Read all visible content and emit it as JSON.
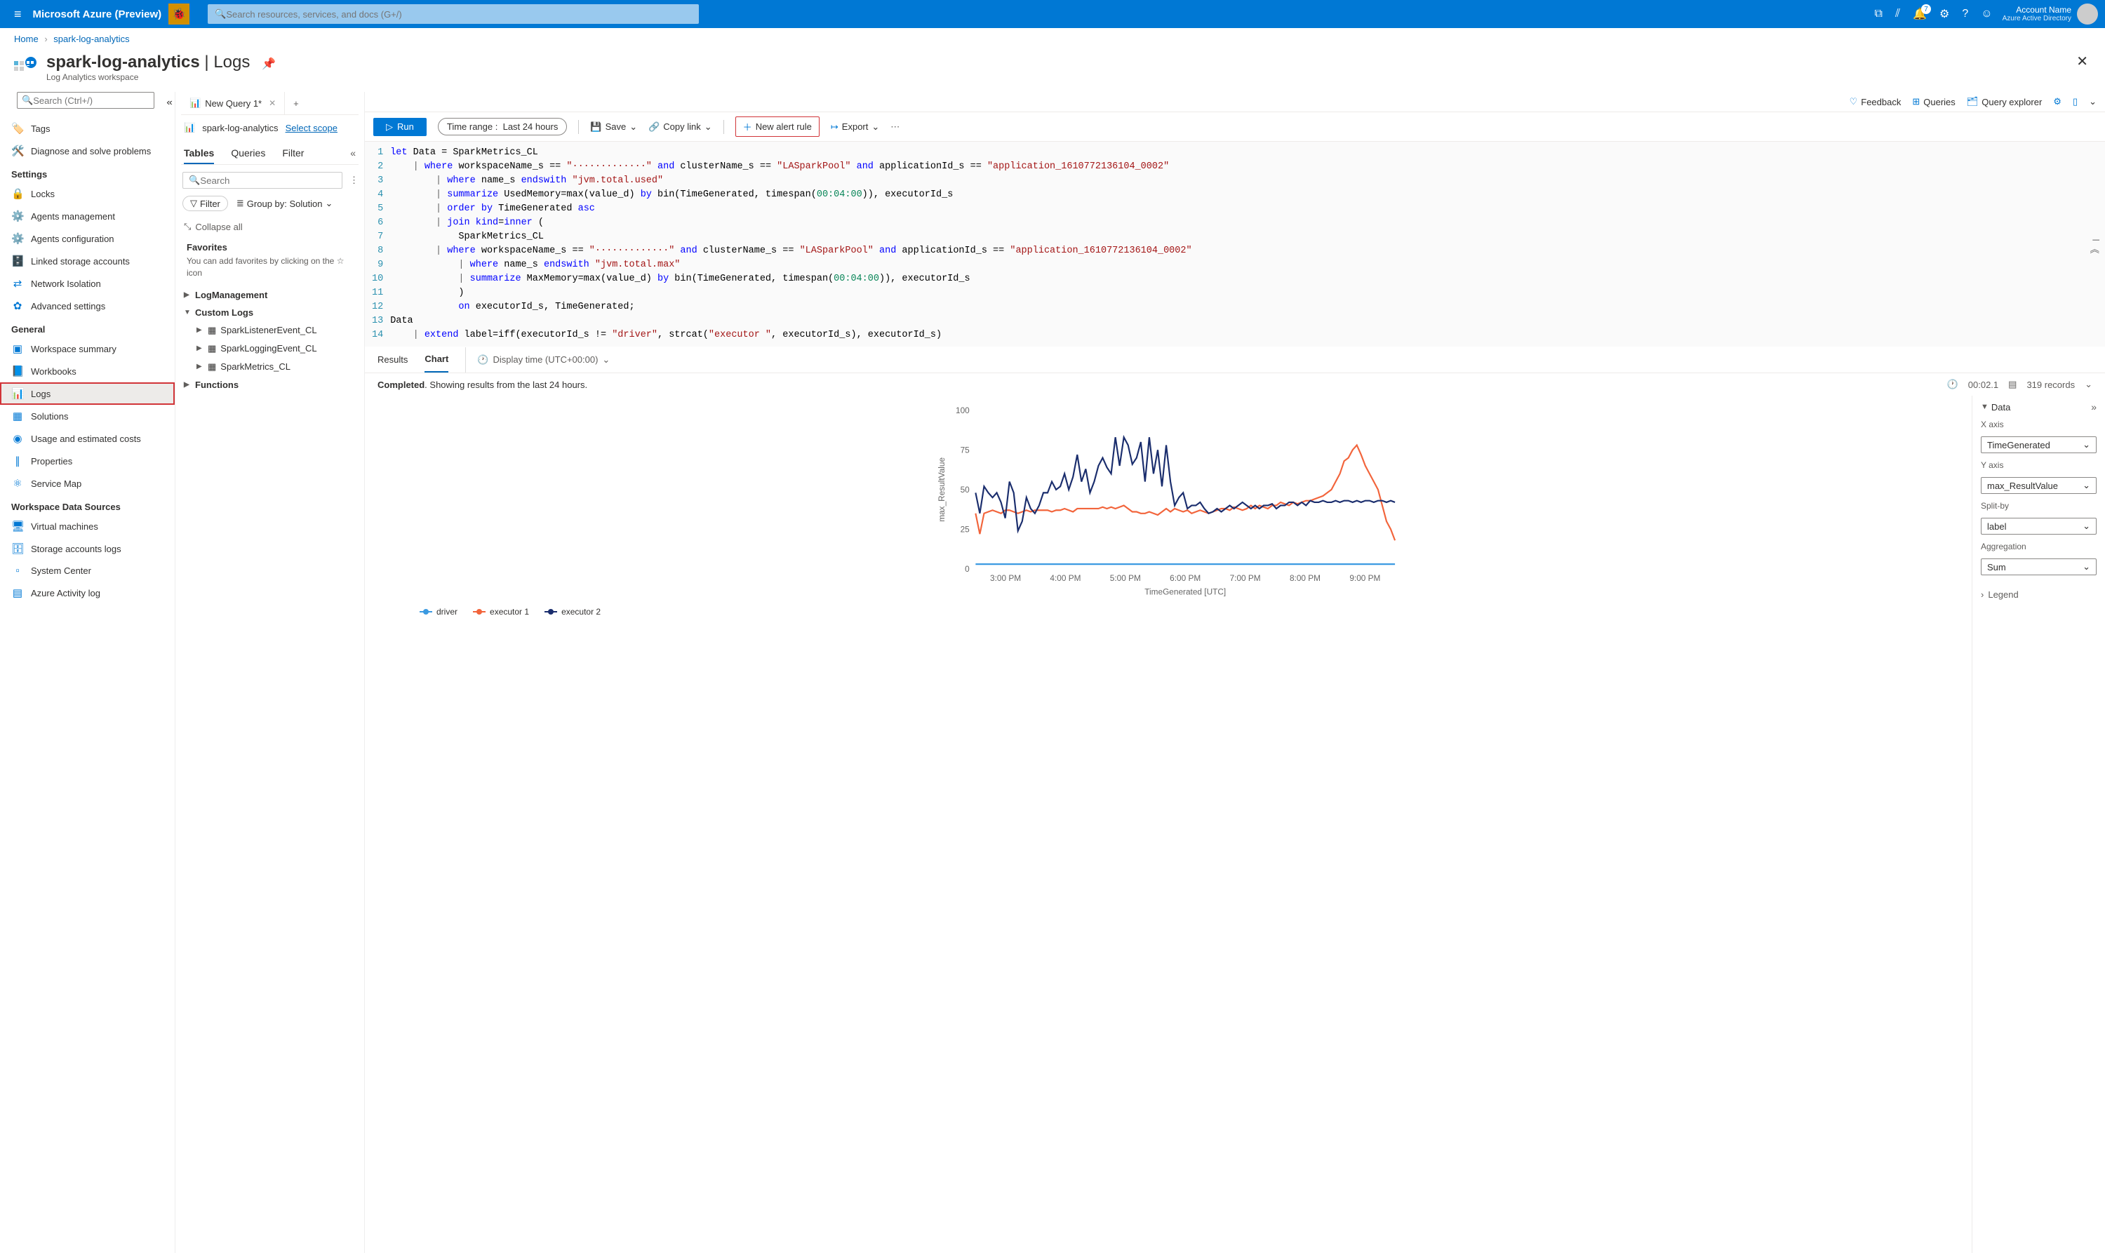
{
  "topbar": {
    "brand": "Microsoft Azure (Preview)",
    "search_placeholder": "Search resources, services, and docs (G+/)",
    "notif_count": "7",
    "account_name": "Account Name",
    "tenant": "Azure Active Directory"
  },
  "breadcrumb": {
    "home": "Home",
    "current": "spark-log-analytics"
  },
  "page": {
    "title_main": "spark-log-analytics",
    "title_sep": " | ",
    "title_section": "Logs",
    "subtitle": "Log Analytics workspace"
  },
  "sidebar_search_placeholder": "Search (Ctrl+/)",
  "sidebar": {
    "top": [
      {
        "icon": "🏷️",
        "label": "Tags",
        "color": "#8a4fbf"
      },
      {
        "icon": "🛠️",
        "label": "Diagnose and solve problems",
        "color": "#605e5c"
      }
    ],
    "settings_label": "Settings",
    "settings": [
      {
        "icon": "🔒",
        "label": "Locks",
        "color": "#0078d4"
      },
      {
        "icon": "⚙️",
        "label": "Agents management",
        "color": "#0078d4"
      },
      {
        "icon": "⚙️",
        "label": "Agents configuration",
        "color": "#0078d4"
      },
      {
        "icon": "🗄️",
        "label": "Linked storage accounts",
        "color": "#0078d4"
      },
      {
        "icon": "⇄",
        "label": "Network Isolation",
        "color": "#0078d4"
      },
      {
        "icon": "✿",
        "label": "Advanced settings",
        "color": "#0078d4"
      }
    ],
    "general_label": "General",
    "general": [
      {
        "icon": "▣",
        "label": "Workspace summary"
      },
      {
        "icon": "📘",
        "label": "Workbooks"
      },
      {
        "icon": "📊",
        "label": "Logs",
        "selected": true
      },
      {
        "icon": "▦",
        "label": "Solutions"
      },
      {
        "icon": "◉",
        "label": "Usage and estimated costs"
      },
      {
        "icon": "∥",
        "label": "Properties"
      },
      {
        "icon": "⚛",
        "label": "Service Map"
      }
    ],
    "datasources_label": "Workspace Data Sources",
    "datasources": [
      {
        "icon": "🖥",
        "label": "Virtual machines"
      },
      {
        "icon": "🗄",
        "label": "Storage accounts logs"
      },
      {
        "icon": "▫",
        "label": "System Center"
      },
      {
        "icon": "▤",
        "label": "Azure Activity log"
      }
    ]
  },
  "query_tab": {
    "label": "New Query 1*",
    "add": "+"
  },
  "scope": {
    "workspace": "spark-log-analytics",
    "select": "Select scope"
  },
  "sec_tabs": {
    "tables": "Tables",
    "queries": "Queries",
    "filter": "Filter"
  },
  "tbl_search_placeholder": "Search",
  "filter_btn": "Filter",
  "groupby": "Group by: Solution",
  "collapse_all": "Collapse all",
  "favorites": {
    "title": "Favorites",
    "hint": "You can add favorites by clicking on the ☆ icon"
  },
  "tree": {
    "log_mgmt": "LogManagement",
    "custom_logs": "Custom Logs",
    "custom_items": [
      "SparkListenerEvent_CL",
      "SparkLoggingEvent_CL",
      "SparkMetrics_CL"
    ],
    "functions": "Functions"
  },
  "top_actions": {
    "feedback": "Feedback",
    "queries": "Queries",
    "explorer": "Query explorer"
  },
  "toolbar": {
    "run": "Run",
    "time_label": "Time range :",
    "time_value": "Last 24 hours",
    "save": "Save",
    "copy": "Copy link",
    "alert": "New alert rule",
    "export": "Export"
  },
  "code_lines": [
    "let Data = SparkMetrics_CL",
    "    | where workspaceName_s == \"·············\" and clusterName_s == \"LASparkPool\" and applicationId_s == \"application_1610772136104_0002\"",
    "        | where name_s endswith \"jvm.total.used\"",
    "        | summarize UsedMemory=max(value_d) by bin(TimeGenerated, timespan(00:04:00)), executorId_s",
    "        | order by TimeGenerated asc",
    "        | join kind=inner (",
    "            SparkMetrics_CL",
    "        | where workspaceName_s == \"·············\" and clusterName_s == \"LASparkPool\" and applicationId_s == \"application_1610772136104_0002\"",
    "            | where name_s endswith \"jvm.total.max\"",
    "            | summarize MaxMemory=max(value_d) by bin(TimeGenerated, timespan(00:04:00)), executorId_s",
    "            )",
    "            on executorId_s, TimeGenerated;",
    "Data",
    "    | extend label=iff(executorId_s != \"driver\", strcat(\"executor \", executorId_s), executorId_s)"
  ],
  "results": {
    "tab_results": "Results",
    "tab_chart": "Chart",
    "display_time": "Display time (UTC+00:00)",
    "status_completed": "Completed",
    "status_text": ". Showing results from the last 24 hours.",
    "duration": "00:02.1",
    "records": "319 records"
  },
  "chart_config": {
    "data_header": "Data",
    "x_axis_label": "X axis",
    "x_axis_value": "TimeGenerated",
    "y_axis_label": "Y axis",
    "y_axis_value": "max_ResultValue",
    "split_label": "Split-by",
    "split_value": "label",
    "agg_label": "Aggregation",
    "agg_value": "Sum",
    "legend_label": "Legend"
  },
  "legend": {
    "s1": "driver",
    "s2": "executor 1",
    "s3": "executor 2"
  },
  "chart_data": {
    "type": "line",
    "xlabel": "TimeGenerated [UTC]",
    "ylabel": "max_ResultValue",
    "ylim": [
      0,
      100
    ],
    "x_ticks": [
      "3:00 PM",
      "4:00 PM",
      "5:00 PM",
      "6:00 PM",
      "7:00 PM",
      "8:00 PM",
      "9:00 PM"
    ],
    "y_ticks": [
      0,
      25,
      50,
      75,
      100
    ],
    "series": [
      {
        "name": "driver",
        "color": "#3b9ae1",
        "values": [
          3,
          3,
          3,
          3,
          3,
          3,
          3,
          3,
          3,
          3,
          3,
          3,
          3,
          3,
          3,
          3,
          3,
          3,
          3,
          3,
          3,
          3,
          3,
          3,
          3,
          3,
          3,
          3,
          3,
          3,
          3,
          3,
          3,
          3,
          3,
          3,
          3,
          3,
          3,
          3,
          3,
          3,
          3,
          3,
          3,
          3,
          3,
          3,
          3,
          3,
          3,
          3,
          3,
          3,
          3,
          3,
          3,
          3,
          3,
          3,
          3,
          3,
          3,
          3,
          3,
          3,
          3,
          3,
          3,
          3,
          3,
          3,
          3,
          3,
          3,
          3,
          3,
          3,
          3,
          3,
          3,
          3,
          3,
          3,
          3,
          3,
          3,
          3,
          3,
          3,
          3,
          3,
          3,
          3,
          3,
          3,
          3,
          3,
          3,
          3
        ]
      },
      {
        "name": "executor 1",
        "color": "#f2643b",
        "values": [
          35,
          22,
          35,
          36,
          37,
          36,
          35,
          37,
          37,
          36,
          35,
          36,
          37,
          36,
          37,
          37,
          37,
          37,
          36,
          37,
          37,
          38,
          37,
          36,
          38,
          38,
          38,
          38,
          38,
          38,
          39,
          38,
          39,
          38,
          39,
          40,
          38,
          36,
          36,
          35,
          35,
          36,
          35,
          34,
          36,
          38,
          36,
          38,
          37,
          36,
          37,
          35,
          36,
          37,
          36,
          35,
          36,
          37,
          38,
          38,
          37,
          39,
          38,
          37,
          38,
          40,
          38,
          40,
          39,
          38,
          40,
          40,
          42,
          41,
          40,
          42,
          41,
          42,
          43,
          43,
          44,
          45,
          46,
          48,
          50,
          55,
          60,
          68,
          70,
          75,
          78,
          72,
          65,
          60,
          55,
          50,
          40,
          30,
          25,
          18
        ]
      },
      {
        "name": "executor 2",
        "color": "#1a2d6d",
        "values": [
          48,
          35,
          52,
          48,
          45,
          48,
          42,
          32,
          55,
          48,
          24,
          30,
          45,
          38,
          35,
          40,
          48,
          48,
          55,
          50,
          52,
          60,
          50,
          58,
          72,
          55,
          63,
          48,
          55,
          65,
          70,
          64,
          60,
          83,
          65,
          83,
          78,
          66,
          70,
          80,
          55,
          83,
          60,
          75,
          52,
          78,
          55,
          40,
          45,
          48,
          38,
          40,
          40,
          42,
          38,
          35,
          36,
          38,
          36,
          38,
          40,
          38,
          40,
          42,
          40,
          38,
          40,
          38,
          40,
          40,
          41,
          38,
          40,
          40,
          42,
          42,
          40,
          42,
          40,
          43,
          42,
          42,
          43,
          42,
          42,
          43,
          42,
          43,
          43,
          42,
          43,
          42,
          43,
          43,
          42,
          43,
          43,
          42,
          43,
          42
        ]
      }
    ]
  }
}
